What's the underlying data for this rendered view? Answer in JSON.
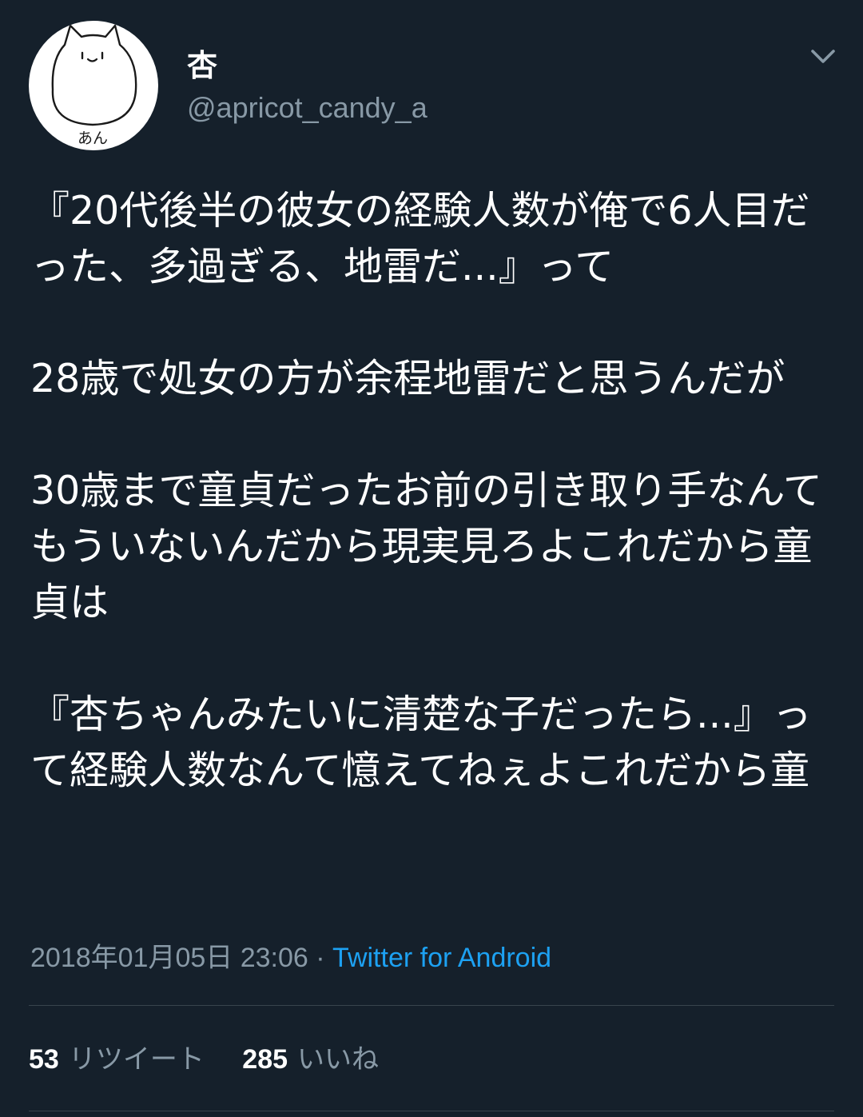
{
  "tweet": {
    "author": {
      "display_name": "杏",
      "handle": "@apricot_candy_a",
      "avatar_label": "あん"
    },
    "menu_icon": "chevron-down-icon",
    "body_paragraphs": [
      "『20代後半の彼女の経験人数が俺で6人目だった、多過ぎる、地雷だ...』って",
      "28歳で処女の方が余程地雷だと思うんだが",
      "30歳まで童貞だったお前の引き取り手なんてもういないんだから現実見ろよこれだから童貞は",
      "『杏ちゃんみたいに清楚な子だったら...』って経験人数なんて憶えてねぇよこれだから童"
    ],
    "timestamp": "2018年01月05日 23:06",
    "separator": "·",
    "source": "Twitter for Android",
    "stats": {
      "retweets_count": "53",
      "retweets_label": "リツイート",
      "likes_count": "285",
      "likes_label": "いいね"
    }
  },
  "colors": {
    "background": "#15202b",
    "text": "#ffffff",
    "secondary": "#8899a6",
    "link": "#1da1f2",
    "divider": "#38444d"
  }
}
